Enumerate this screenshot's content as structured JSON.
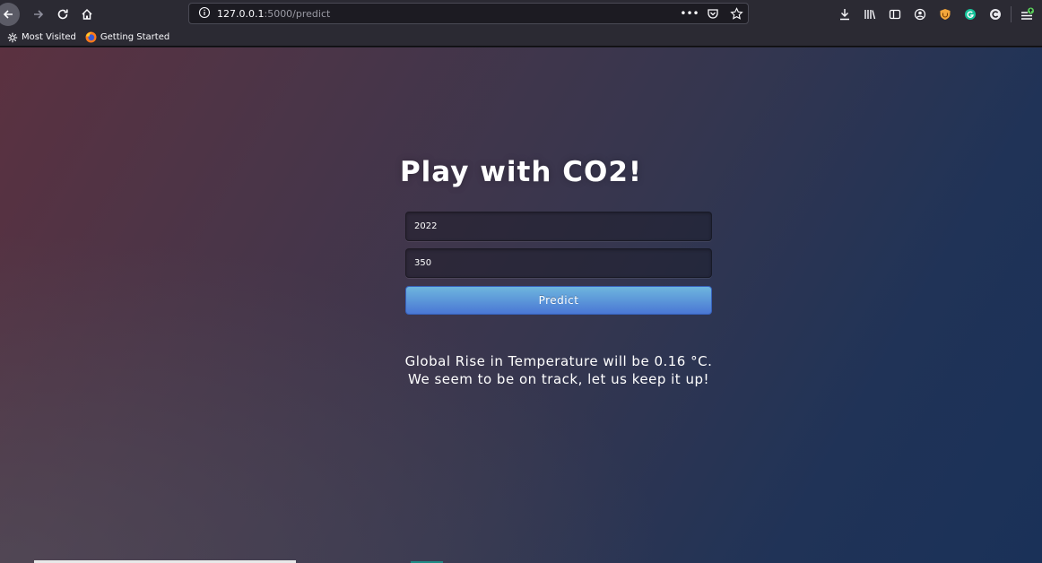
{
  "browser": {
    "url_host": "127.0.0.1",
    "url_path": ":5000/predict",
    "page_actions_label": "•••",
    "bookmarks": [
      {
        "label": "Most Visited",
        "icon": "gear-icon"
      },
      {
        "label": "Getting Started",
        "icon": "firefox-icon"
      }
    ],
    "toolbar_icons": [
      "download-icon",
      "library-icon",
      "sidebar-icon",
      "account-icon",
      "ublock-icon",
      "grammarly-icon",
      "extension-icon",
      "menu-icon"
    ]
  },
  "page": {
    "title": "Play with CO2!",
    "year_value": "2022",
    "co2_value": "350",
    "predict_label": "Predict",
    "result_text": "Global Rise in Temperature will be 0.16 °C. We seem to be on track, let us keep it up!"
  },
  "colors": {
    "button_top": "#6eb6de",
    "button_bottom": "#4a77d4",
    "bg_left": "#5b3140",
    "bg_right": "#1a3158"
  }
}
